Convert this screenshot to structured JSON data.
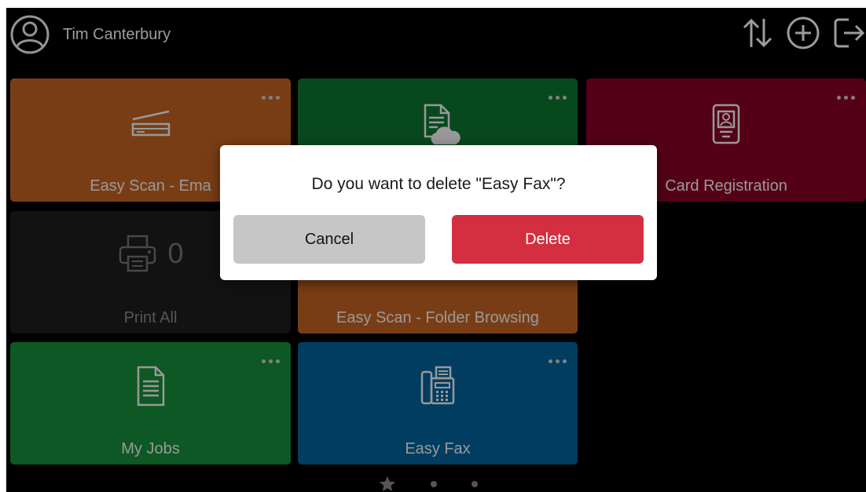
{
  "header": {
    "user_name": "Tim Canterbury",
    "actions": [
      "sort-icon",
      "add-icon",
      "logout-icon"
    ]
  },
  "tiles": [
    {
      "label": "Easy Scan - Ema",
      "icon": "scanner-icon",
      "color": "#b35a1f"
    },
    {
      "label": "",
      "icon": "cloud-document-icon",
      "color": "#0c6a2c"
    },
    {
      "label": "Card Registration",
      "icon": "id-card-icon",
      "color": "#7c0021"
    },
    {
      "label": "Print All",
      "icon": "printer-icon",
      "count": "0",
      "color": "#1b1b1b"
    },
    {
      "label": "Easy Scan - Folder Browsing",
      "icon": "folder-scan-icon",
      "color": "#b35a1f"
    },
    {
      "label": "My Jobs",
      "icon": "document-icon",
      "color": "#148236"
    },
    {
      "label": "Easy Fax",
      "icon": "fax-icon",
      "color": "#005a8f"
    }
  ],
  "pager": {
    "pages": 3,
    "current": 0
  },
  "dialog": {
    "message": "Do you want to delete \"Easy Fax\"?",
    "cancel_label": "Cancel",
    "delete_label": "Delete",
    "delete_color": "#d32f41"
  }
}
